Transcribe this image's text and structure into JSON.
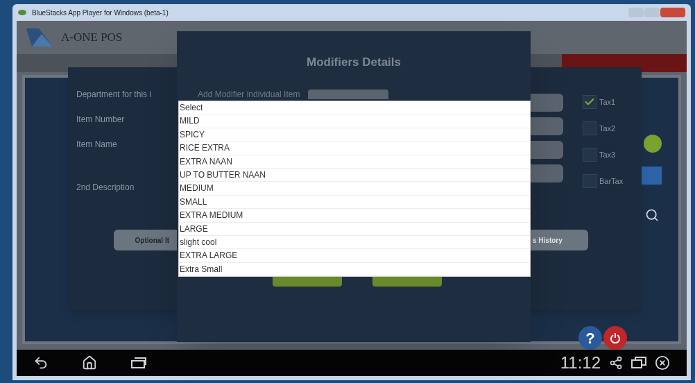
{
  "window": {
    "title": "BlueStacks App Player for Windows (beta-1)"
  },
  "app": {
    "logo": "A-ONE POS",
    "help_button": "?"
  },
  "item_dialog": {
    "fields": [
      {
        "label": "Department for this i"
      },
      {
        "label": "Item Number"
      },
      {
        "label": "Item Name"
      },
      {
        "label": "2nd Description"
      }
    ],
    "taxes": [
      {
        "label": "Tax1",
        "checked": true
      },
      {
        "label": "Tax2",
        "checked": false
      },
      {
        "label": "Tax3",
        "checked": false
      },
      {
        "label": "BarTax",
        "checked": false
      }
    ],
    "buttons": [
      "Optional It",
      "s History"
    ]
  },
  "modifiers_dialog": {
    "title": "Modifiers Details",
    "field_label": "Add Modifier individual Item",
    "options": [
      "Select",
      "MILD",
      "SPICY",
      "RICE EXTRA",
      "EXTRA NAAN",
      "UP TO BUTTER NAAN",
      "MEDIUM",
      "SMALL",
      "EXTRA MEDIUM",
      "LARGE",
      "slight cool",
      "EXTRA LARGE",
      "Extra Small"
    ]
  },
  "nav_bar": {
    "time": "11:12"
  }
}
